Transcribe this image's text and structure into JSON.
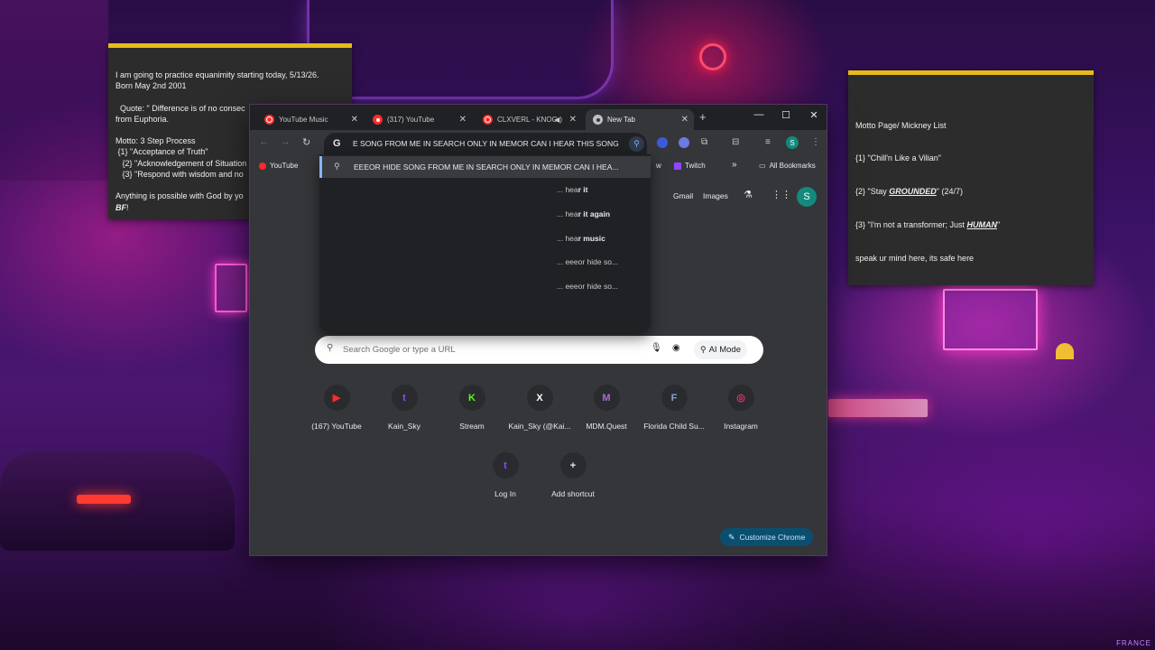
{
  "sticky_left": {
    "lines": [
      "I am going to practice equanimity starting today, 5/13/26.",
      "Born May 2nd 2001",
      "",
      "  Quote: \" Difference is of no consec",
      "from Euphoria.",
      "",
      "Motto: 3 Step Process",
      " {1} \"Acceptance of Truth\"",
      "   {2} \"Acknowledgement of Situation",
      "   {3} \"Respond with wisdom and no",
      "",
      "Anything is possible with God by yo"
    ],
    "last_line_bold": "BF",
    "last_line_end": "!"
  },
  "sticky_right": {
    "line1": "Motto Page/ Mickney List",
    "line2": "{1} \"Chill'n Like a Vilian\"",
    "line3_pre": "{2} \"Stay ",
    "line3_em": "GROUNDED",
    "line3_post": "\" (24/7)",
    "line4_pre": "{3} \"I'm not a transformer; Just ",
    "line4_em": "HUMAN",
    "line4_post": "\"",
    "line5": "speak ur mind here, its safe here"
  },
  "tabs": [
    {
      "title": "YouTube Music"
    },
    {
      "title": "(317) YouTube"
    },
    {
      "title": "CLXVERL - KNOC"
    },
    {
      "title": "New Tab"
    }
  ],
  "omnibox": {
    "g_label": "G",
    "text": "E SONG FROM ME IN SEARCH ONLY IN MEMOR CAN I HEAR THIS SONG"
  },
  "bookmarks": {
    "youtube": "YouTube",
    "w": "w",
    "twitch": "Twitch",
    "more": "»",
    "all_bookmarks": "All Bookmarks"
  },
  "dropdown": {
    "first": "EEEOR HIDE SONG FROM ME IN SEARCH ONLY IN MEMOR CAN I HEA...",
    "items": [
      {
        "pre": "... hea",
        "post": "r it"
      },
      {
        "pre": "... hea",
        "post": "r it again"
      },
      {
        "pre": "... hea",
        "post": "r music"
      },
      {
        "pre": "... eeeor hide so...",
        "post": ""
      },
      {
        "pre": "... eeeor hide so...",
        "post": ""
      }
    ]
  },
  "ntp": {
    "gmail": "Gmail",
    "images": "Images",
    "avatar": "S",
    "search_placeholder": "Search Google or type a URL",
    "ai_mode": "AI Mode",
    "customize": "Customize Chrome",
    "shortcuts": [
      {
        "label": "(167) YouTube",
        "glyph": "▶",
        "color": "#ff2a2a"
      },
      {
        "label": "Kain_Sky",
        "glyph": "t",
        "color": "#9146ff"
      },
      {
        "label": "Stream",
        "glyph": "K",
        "color": "#53fc18"
      },
      {
        "label": "Kain_Sky (@Kai...",
        "glyph": "X",
        "color": "#ffffff"
      },
      {
        "label": "MDM.Quest",
        "glyph": "M",
        "color": "#b06ad6"
      },
      {
        "label": "Florida Child Su...",
        "glyph": "F",
        "color": "#8aa0d0"
      },
      {
        "label": "Instagram",
        "glyph": "◎",
        "color": "#e1306c"
      },
      {
        "label": "Log In",
        "glyph": "t",
        "color": "#9146ff"
      },
      {
        "label": "Add shortcut",
        "glyph": "+",
        "color": "#e8eaed"
      }
    ]
  },
  "profile_initial": "S",
  "corner_brand": "FRANCE"
}
